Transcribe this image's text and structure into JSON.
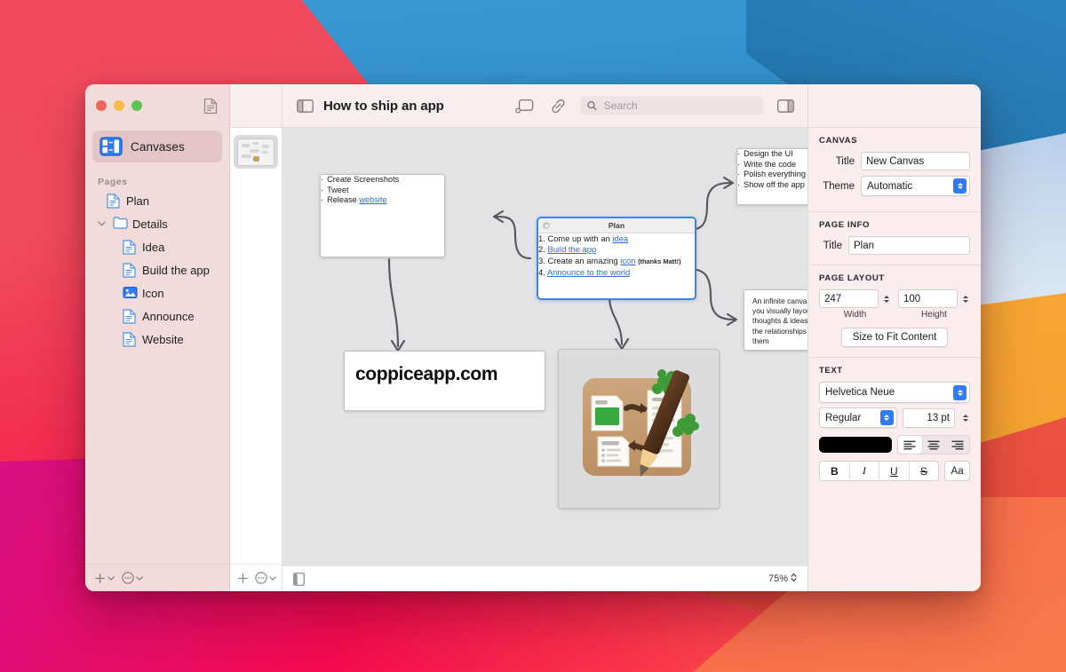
{
  "window": {
    "title": "How to ship an app",
    "traffic_lights": [
      "close",
      "minimize",
      "zoom"
    ]
  },
  "sidebar": {
    "canvases_label": "Canvases",
    "pages_header": "Pages",
    "pages": [
      {
        "label": "Plan",
        "icon": "page-icon",
        "level": 0,
        "type": "page"
      },
      {
        "label": "Details",
        "icon": "folder-icon",
        "level": 0,
        "type": "folder",
        "expanded": true
      },
      {
        "label": "Idea",
        "icon": "page-icon",
        "level": 1,
        "type": "page"
      },
      {
        "label": "Build the app",
        "icon": "page-icon",
        "level": 1,
        "type": "page"
      },
      {
        "label": "Icon",
        "icon": "image-icon",
        "level": 1,
        "type": "image"
      },
      {
        "label": "Announce",
        "icon": "page-icon",
        "level": 1,
        "type": "page"
      },
      {
        "label": "Website",
        "icon": "page-icon",
        "level": 1,
        "type": "page"
      }
    ],
    "footer": {
      "add": "add-page-button",
      "more": "more-options-button"
    }
  },
  "toolbar": {
    "sidebar_toggle": "sidebar-toggle-icon",
    "new_page": "new-page-icon",
    "link": "link-icon",
    "inspector_toggle": "inspector-toggle-icon",
    "search_placeholder": "Search",
    "search_value": ""
  },
  "statusbar": {
    "add": "add-button",
    "more": "more-button",
    "thumbnail_toggle": "thumbnail-toggle-icon",
    "zoom": "75%"
  },
  "canvas": {
    "background": "#e3e3e5",
    "cards": [
      {
        "id": "checklist",
        "type": "bullets",
        "items": [
          {
            "text": "Create Screenshots"
          },
          {
            "text": "Tweet"
          },
          {
            "text": "Release ",
            "link": "website"
          }
        ]
      },
      {
        "id": "plan",
        "type": "numbered",
        "selected": true,
        "title": "Plan",
        "items": [
          {
            "n": "1.",
            "text": "Come up with an ",
            "link": "idea"
          },
          {
            "n": "2.",
            "link": "Build the app"
          },
          {
            "n": "3.",
            "text": "Create an amazing ",
            "link": "icon",
            "after": "(thanks Matt!)"
          },
          {
            "n": "4.",
            "link": "Announce to the world"
          }
        ]
      },
      {
        "id": "tasks",
        "type": "bullets",
        "items": [
          {
            "text": "Design the UI"
          },
          {
            "text": "Write the code"
          },
          {
            "text": "Polish everything"
          },
          {
            "text": "Show off the app"
          }
        ]
      },
      {
        "id": "description",
        "type": "paragraph",
        "text": "An infinite canvas that lets you visually layout your thoughts & ideas and see the relationships between them"
      },
      {
        "id": "url",
        "type": "heading",
        "text": "coppiceapp.com"
      },
      {
        "id": "appicon",
        "type": "image",
        "alt": "coppice-app-icon"
      }
    ]
  },
  "inspector": {
    "canvas": {
      "section": "CANVAS",
      "title_label": "Title",
      "title_value": "New Canvas",
      "theme_label": "Theme",
      "theme_value": "Automatic"
    },
    "page_info": {
      "section": "PAGE INFO",
      "title_label": "Title",
      "title_value": "Plan"
    },
    "page_layout": {
      "section": "PAGE LAYOUT",
      "width_value": "247",
      "width_label": "Width",
      "height_value": "100",
      "height_label": "Height",
      "fit_button": "Size to Fit Content"
    },
    "text": {
      "section": "TEXT",
      "font_family": "Helvetica Neue",
      "font_weight": "Regular",
      "font_size": "13 pt",
      "color": "#000000",
      "align": [
        "left",
        "center",
        "right"
      ],
      "align_selected": "left",
      "styles": [
        "B",
        "I",
        "U",
        "S"
      ],
      "aa_label": "Aa"
    }
  }
}
